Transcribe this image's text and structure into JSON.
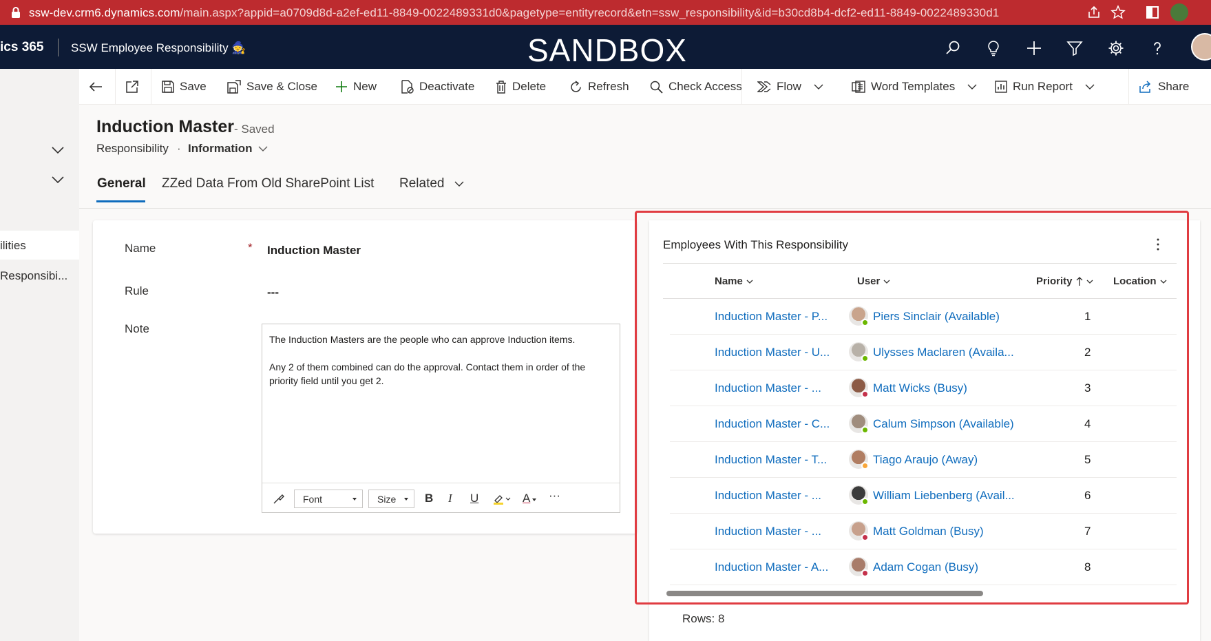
{
  "browser": {
    "url_host": "ssw-dev.crm6.dynamics.com",
    "url_rest": "/main.aspx?appid=a0709d8d-a2ef-ed11-8849-0022489331d0&pagetype=entityrecord&etn=ssw_responsibility&id=b30cd8b4-dcf2-ed11-8849-0022489330d1"
  },
  "appbar": {
    "brand": "ics 365",
    "app_name": "SSW Employee Responsibility 🧙",
    "banner": "SANDBOX"
  },
  "leftnav": {
    "items": [
      {
        "label": "ilities"
      },
      {
        "label": "Responsibi..."
      }
    ]
  },
  "commands": {
    "save": "Save",
    "save_close": "Save & Close",
    "new": "New",
    "deactivate": "Deactivate",
    "delete": "Delete",
    "refresh": "Refresh",
    "check_access": "Check Access",
    "flow": "Flow",
    "word_templates": "Word Templates",
    "run_report": "Run Report",
    "share": "Share"
  },
  "record": {
    "title": "Induction Master",
    "saved": "- Saved",
    "entity": "Responsibility",
    "dot": "·",
    "form": "Information"
  },
  "tabs": [
    "General",
    "ZZed Data From Old SharePoint List",
    "Related"
  ],
  "form": {
    "name_label": "Name",
    "required_mark": "*",
    "name_value": "Induction Master",
    "rule_label": "Rule",
    "rule_value": "---",
    "note_label": "Note",
    "note_value": "The Induction Masters are the people who can approve Induction items.\n\nAny 2 of them combined can do the approval. Contact them in order of the priority field until you get 2.",
    "toolbar": {
      "font": "Font",
      "size": "Size",
      "bold": "B",
      "italic": "I",
      "underline": "U",
      "font_color": "A",
      "more": "···"
    }
  },
  "subgrid": {
    "title": "Employees With This Responsibility",
    "columns": {
      "name": "Name",
      "user": "User",
      "priority": "Priority",
      "location": "Location"
    },
    "rows": [
      {
        "name": "Induction Master - P...",
        "user": "Piers Sinclair (Available)",
        "priority": "1",
        "status": "available",
        "avatar_color": "#c9a48c"
      },
      {
        "name": "Induction Master - U...",
        "user": "Ulysses Maclaren (Availa...",
        "priority": "2",
        "status": "available",
        "avatar_color": "#b8b1a8"
      },
      {
        "name": "Induction Master - ...",
        "user": "Matt Wicks (Busy)",
        "priority": "3",
        "status": "busy",
        "avatar_color": "#8c5a45"
      },
      {
        "name": "Induction Master - C...",
        "user": "Calum Simpson (Available)",
        "priority": "4",
        "status": "available",
        "avatar_color": "#a08d7e"
      },
      {
        "name": "Induction Master - T...",
        "user": "Tiago Araujo (Away)",
        "priority": "5",
        "status": "away",
        "avatar_color": "#b07d62"
      },
      {
        "name": "Induction Master - ...",
        "user": "William Liebenberg (Avail...",
        "priority": "6",
        "status": "available",
        "avatar_color": "#3b3b3b"
      },
      {
        "name": "Induction Master - ...",
        "user": "Matt Goldman (Busy)",
        "priority": "7",
        "status": "busy",
        "avatar_color": "#c7a08c"
      },
      {
        "name": "Induction Master - A...",
        "user": "Adam Cogan (Busy)",
        "priority": "8",
        "status": "busy",
        "avatar_color": "#a87c6a"
      }
    ],
    "rows_label": "Rows: 8"
  },
  "colors": {
    "browser_bar": "#bd2b2f",
    "app_header": "#0d1b36",
    "link": "#0f6cbd",
    "highlight": "#e03c41",
    "available": "#6bb700",
    "busy": "#c4314b",
    "away": "#f8a63a"
  }
}
